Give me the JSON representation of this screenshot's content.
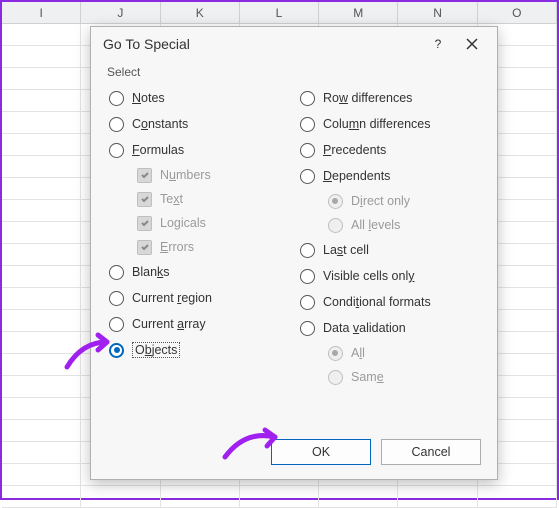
{
  "columns": [
    "I",
    "J",
    "K",
    "L",
    "M",
    "N",
    "O"
  ],
  "dialog": {
    "title": "Go To Special",
    "section_label": "Select",
    "left": {
      "notes": "Notes",
      "constants": "Constants",
      "formulas": "Formulas",
      "numbers": "Numbers",
      "text": "Text",
      "logicals": "Logicals",
      "errors": "Errors",
      "blanks": "Blanks",
      "current_region": "Current region",
      "current_array": "Current array",
      "objects": "Objects"
    },
    "right": {
      "row_diff": "Row differences",
      "col_diff": "Column differences",
      "precedents": "Precedents",
      "dependents": "Dependents",
      "direct_only": "Direct only",
      "all_levels": "All levels",
      "last_cell": "Last cell",
      "visible_cells": "Visible cells only",
      "cond_formats": "Conditional formats",
      "data_validation": "Data validation",
      "all": "All",
      "same": "Same"
    },
    "ok": "OK",
    "cancel": "Cancel"
  }
}
